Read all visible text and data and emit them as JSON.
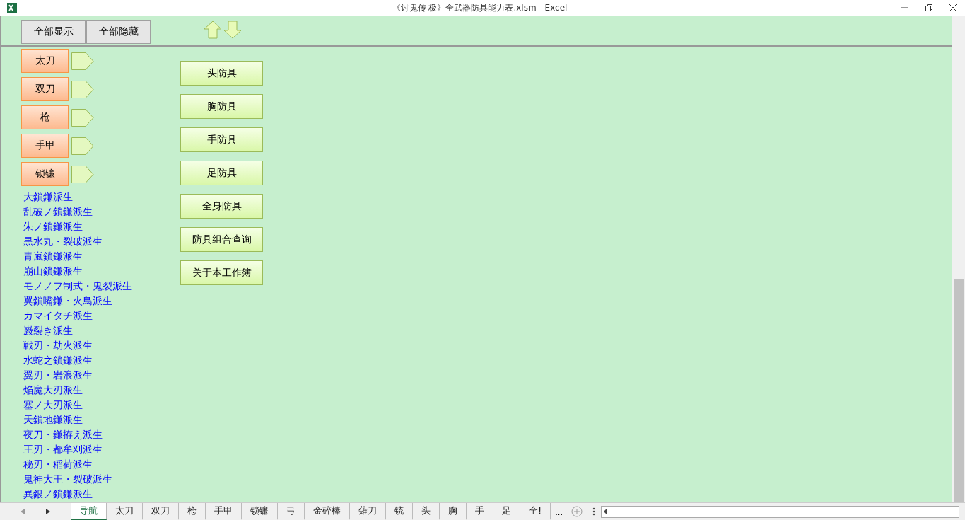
{
  "window": {
    "title": "《讨鬼传 极》全武器防具能力表.xlsm - Excel"
  },
  "top_buttons": [
    "全部显示",
    "全部隐藏"
  ],
  "weapons": [
    {
      "label": "太刀"
    },
    {
      "label": "双刀"
    },
    {
      "label": "枪"
    },
    {
      "label": "手甲"
    },
    {
      "label": "锁镰"
    }
  ],
  "links": [
    "大鎖鎌派生",
    "乱破ノ鎖鎌派生",
    "朱ノ鎖鎌派生",
    "黒水丸・裂破派生",
    "青嵐鎖鎌派生",
    "崩山鎖鎌派生",
    "モノノフ制式・鬼裂派生",
    "翼鎖嘴鎌・火鳥派生",
    "カマイタチ派生",
    "巌裂き派生",
    "戦刃・劫火派生",
    "水蛇之鎖鎌派生",
    "翼刃・岩浪派生",
    "焔魔大刃派生",
    "塞ノ大刃派生",
    "天鎖地鎌派生",
    "夜刀・鎌拵え派生",
    "王刃・都牟刈派生",
    "秘刃・稲荷派生",
    "鬼神大王・裂破派生",
    "異銀ノ鎖鎌派生"
  ],
  "armor_buttons": [
    "头防具",
    "胸防具",
    "手防具",
    "足防具",
    "全身防具",
    "防具组合查询",
    "关于本工作簿"
  ],
  "sheet_tabs": [
    {
      "label": "导航",
      "selected": true
    },
    {
      "label": "太刀",
      "selected": false
    },
    {
      "label": "双刀",
      "selected": false
    },
    {
      "label": "枪",
      "selected": false
    },
    {
      "label": "手甲",
      "selected": false
    },
    {
      "label": "锁镰",
      "selected": false
    },
    {
      "label": "弓",
      "selected": false
    },
    {
      "label": "金碎棒",
      "selected": false
    },
    {
      "label": "薙刀",
      "selected": false
    },
    {
      "label": "铳",
      "selected": false
    },
    {
      "label": "头",
      "selected": false
    },
    {
      "label": "胸",
      "selected": false
    },
    {
      "label": "手",
      "selected": false
    },
    {
      "label": "足",
      "selected": false
    },
    {
      "label": "全!",
      "selected": false
    }
  ],
  "more_tabs": "..."
}
